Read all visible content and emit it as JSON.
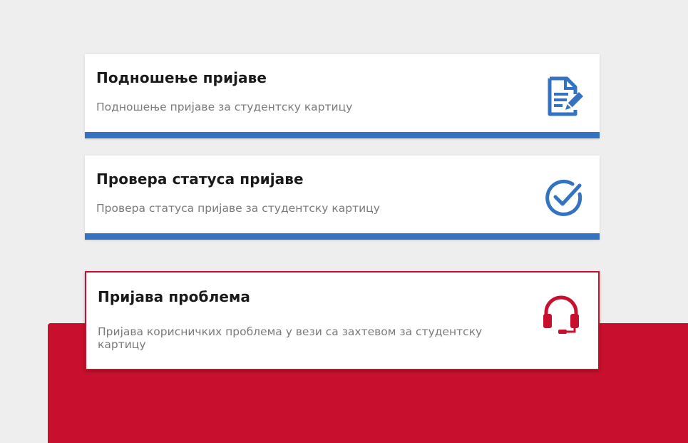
{
  "cards": [
    {
      "title": "Подношење пријаве",
      "description": "Подношење пријаве за студентску картицу",
      "icon": "document-edit-icon",
      "accent": "#3472c2"
    },
    {
      "title": "Провера статуса пријаве",
      "description": "Провера статуса пријаве за студентску картицу",
      "icon": "check-circle-icon",
      "accent": "#3472c2"
    },
    {
      "title": "Пријава проблема",
      "description": "Пријава корисничких проблема у вези са захтевом за студентску картицу",
      "icon": "headset-icon",
      "accent": "#c8102e"
    }
  ],
  "colors": {
    "background": "#eeeeee",
    "brand_red": "#c8102e",
    "brand_blue": "#3472c2"
  }
}
